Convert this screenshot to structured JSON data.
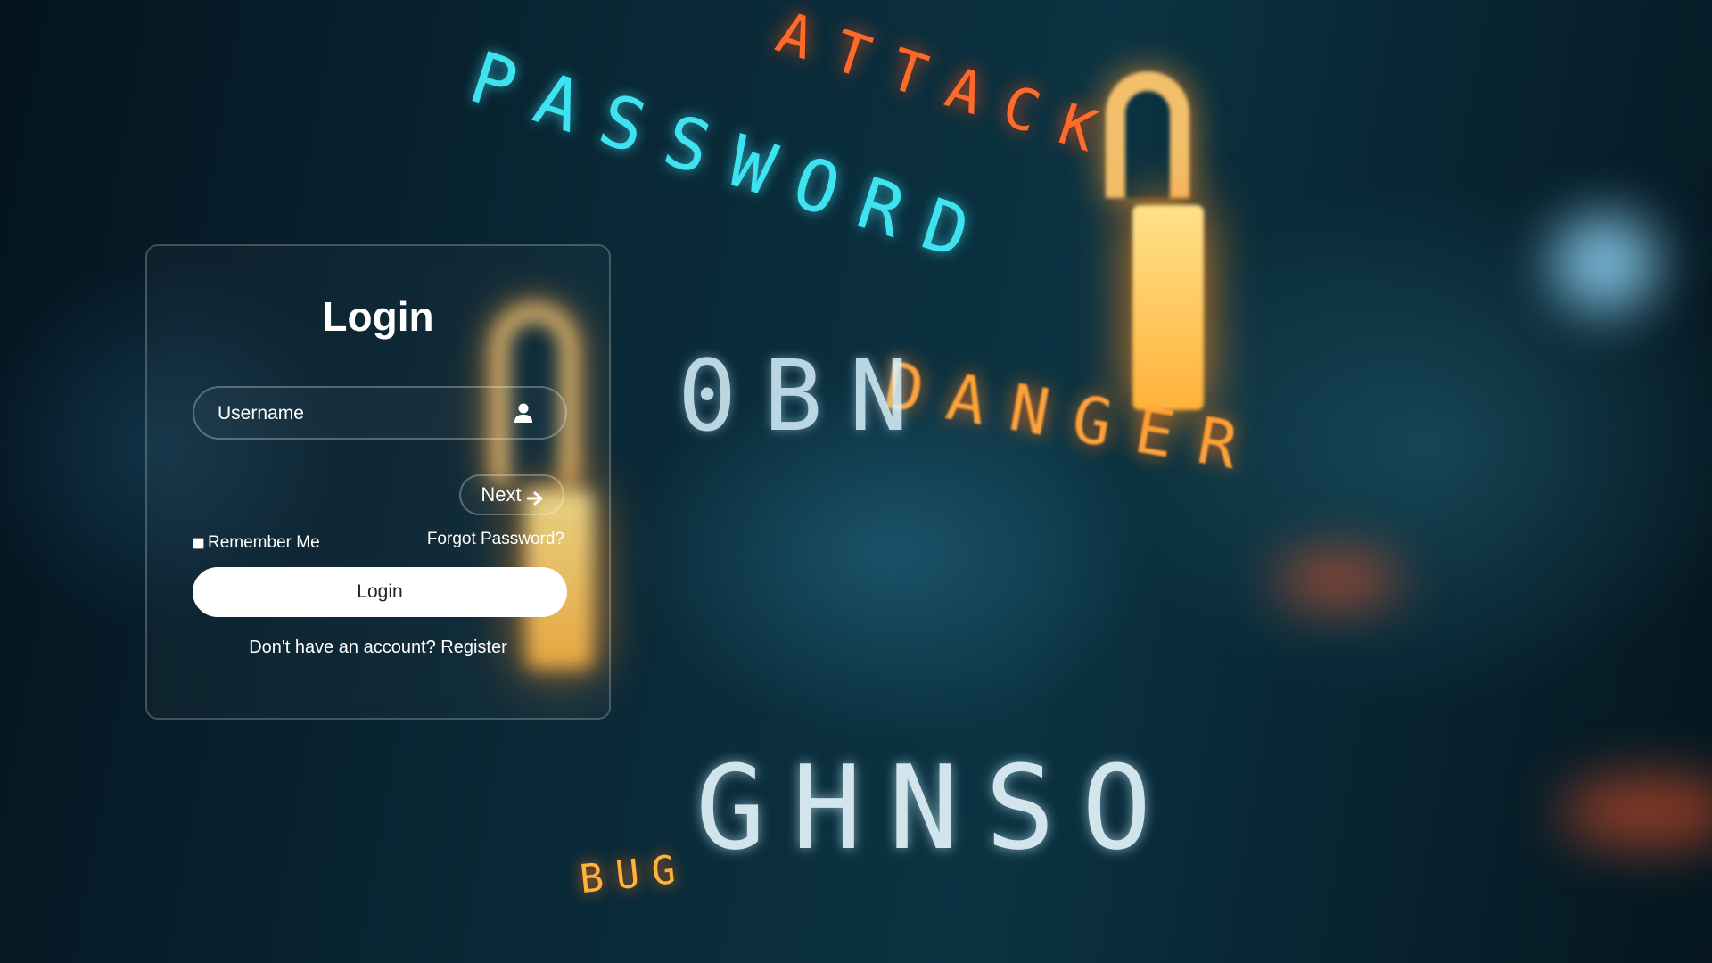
{
  "login": {
    "title": "Login",
    "username_placeholder": "Username",
    "next_label": "Next",
    "remember_label": "Remember Me",
    "forgot_label": "Forgot Password?",
    "login_button_label": "Login",
    "register_prompt": "Don't have an account?",
    "register_label": "Register"
  },
  "background_words": {
    "password": "PASSWORD",
    "attack": "ATTACK",
    "danger": "DANGER",
    "bug": "BUG",
    "codes_1": "0BN",
    "codes_2": "GHNSO"
  },
  "icons": {
    "user": "user-icon",
    "next_arrow": "arrow-right-icon",
    "lock": "padlock-icon"
  },
  "colors": {
    "card_border": "#ffffff",
    "button_bg": "#ffffff",
    "button_text": "#222222",
    "text": "#ffffff",
    "accent_cyan": "#3fe3f0",
    "accent_orange": "#ff7a1a"
  }
}
